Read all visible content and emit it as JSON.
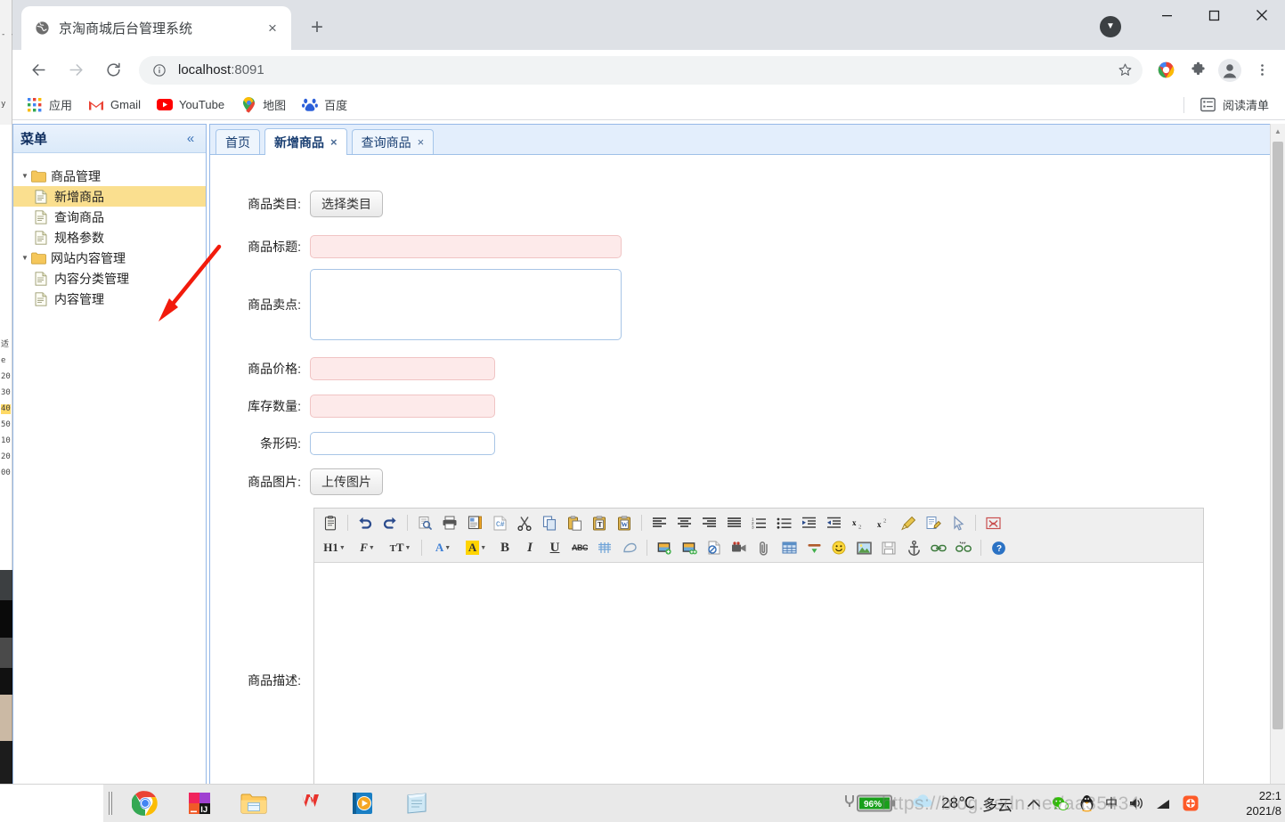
{
  "browser": {
    "tab": {
      "title": "京淘商城后台管理系统",
      "favicon": "globe-icon",
      "close": "×"
    },
    "new_tab": "+",
    "window_controls": {
      "minimize": "minimize-icon",
      "maximize": "maximize-icon",
      "close": "close-icon"
    },
    "alert_badge": "▼",
    "nav": {
      "back": "←",
      "forward": "→",
      "reload": "↻"
    },
    "omnibox": {
      "info_icon": "info-circle-icon",
      "host": "localhost",
      "port": ":8091",
      "star": "star-icon"
    },
    "toolbar_icons": [
      "chrome-profile-color-icon",
      "extensions-puzzle-icon",
      "profile-avatar-icon",
      "three-dot-menu-icon"
    ],
    "bookmarks": [
      {
        "label": "应用",
        "icon": "apps-grid-icon"
      },
      {
        "label": "Gmail",
        "icon": "gmail-icon"
      },
      {
        "label": "YouTube",
        "icon": "youtube-icon"
      },
      {
        "label": "地图",
        "icon": "maps-pin-icon"
      },
      {
        "label": "百度",
        "icon": "baidu-icon"
      }
    ],
    "reading_list": {
      "label": "阅读清单",
      "icon": "reading-list-icon"
    }
  },
  "sidebar": {
    "title": "菜单",
    "collapse_icon": "«",
    "tree": [
      {
        "label": "商品管理",
        "type": "folder",
        "level": 0,
        "selected": false
      },
      {
        "label": "新增商品",
        "type": "file",
        "level": 1,
        "selected": true
      },
      {
        "label": "查询商品",
        "type": "file",
        "level": 1,
        "selected": false
      },
      {
        "label": "规格参数",
        "type": "file",
        "level": 1,
        "selected": false
      },
      {
        "label": "网站内容管理",
        "type": "folder",
        "level": 0,
        "selected": false
      },
      {
        "label": "内容分类管理",
        "type": "file",
        "level": 1,
        "selected": false
      },
      {
        "label": "内容管理",
        "type": "file",
        "level": 1,
        "selected": false
      }
    ]
  },
  "content": {
    "tabs": [
      {
        "label": "首页",
        "closable": false,
        "active": false
      },
      {
        "label": "新增商品",
        "closable": true,
        "active": true
      },
      {
        "label": "查询商品",
        "closable": true,
        "active": false
      }
    ],
    "close_glyph": "×"
  },
  "form": {
    "fields": [
      {
        "label": "商品类目:",
        "control": "button",
        "value": "选择类目",
        "style": "grey"
      },
      {
        "label": "商品标题:",
        "control": "input",
        "value": "",
        "style": "required"
      },
      {
        "label": "商品卖点:",
        "control": "textarea",
        "value": "",
        "style": "normal"
      },
      {
        "label": "商品价格:",
        "control": "input",
        "value": "",
        "style": "required"
      },
      {
        "label": "库存数量:",
        "control": "input",
        "value": "",
        "style": "required"
      },
      {
        "label": "条形码:",
        "control": "input",
        "value": "",
        "style": "normal"
      },
      {
        "label": "商品图片:",
        "control": "button",
        "value": "上传图片",
        "style": "grey"
      },
      {
        "label": "商品描述:",
        "control": "editor",
        "value": "",
        "style": "normal"
      }
    ]
  },
  "editor": {
    "row1": [
      {
        "name": "paste-from-clipboard-icon",
        "glyph": "📋"
      },
      {
        "sep": true
      },
      {
        "name": "undo-icon",
        "glyph": "↶"
      },
      {
        "name": "redo-icon",
        "glyph": "↷"
      },
      {
        "sep": true
      },
      {
        "name": "preview-icon",
        "glyph": "🔍"
      },
      {
        "name": "print-icon",
        "glyph": "🖨"
      },
      {
        "name": "templates-icon",
        "glyph": "▤"
      },
      {
        "name": "source-csharp-icon",
        "glyph": "C#"
      },
      {
        "name": "cut-icon",
        "glyph": "✂"
      },
      {
        "name": "copy-icon",
        "glyph": "⧉"
      },
      {
        "name": "paste-icon",
        "glyph": "📋"
      },
      {
        "name": "paste-as-text-icon",
        "glyph": "T"
      },
      {
        "name": "paste-from-word-icon",
        "glyph": "W"
      },
      {
        "sep": true
      },
      {
        "name": "align-left-icon",
        "glyph": "≡"
      },
      {
        "name": "align-center-icon",
        "glyph": "≡"
      },
      {
        "name": "align-right-icon",
        "glyph": "≡"
      },
      {
        "name": "align-justify-icon",
        "glyph": "≡"
      },
      {
        "name": "numbered-list-icon",
        "glyph": "≣"
      },
      {
        "name": "bulleted-list-icon",
        "glyph": "≣"
      },
      {
        "name": "indent-increase-icon",
        "glyph": "⇥"
      },
      {
        "name": "indent-decrease-icon",
        "glyph": "⇤"
      },
      {
        "name": "subscript-icon",
        "glyph": "x₂"
      },
      {
        "name": "superscript-icon",
        "glyph": "x²"
      },
      {
        "name": "format-painter-icon",
        "glyph": "🧹"
      },
      {
        "name": "edit-source-icon",
        "glyph": "✎"
      },
      {
        "name": "select-cursor-icon",
        "glyph": "➤"
      },
      {
        "sep": true
      },
      {
        "name": "show-blocks-icon",
        "glyph": "⬚"
      }
    ],
    "row2": [
      {
        "name": "heading-h1-icon",
        "glyph": "H1",
        "caret": true,
        "wide": true
      },
      {
        "name": "font-family-icon",
        "glyph": "ℱ",
        "caret": true,
        "wide": true
      },
      {
        "name": "font-size-icon",
        "glyph": "ᴛT",
        "caret": true,
        "wide": true
      },
      {
        "sep": true
      },
      {
        "name": "text-color-icon",
        "glyph": "A",
        "caret": true,
        "wide": true
      },
      {
        "name": "background-color-icon",
        "glyph": "A",
        "caret": true,
        "wide": true
      },
      {
        "name": "bold-icon",
        "glyph": "B"
      },
      {
        "name": "italic-icon",
        "glyph": "I"
      },
      {
        "name": "underline-icon",
        "glyph": "U"
      },
      {
        "name": "strikethrough-icon",
        "glyph": "ABC"
      },
      {
        "name": "remove-format-icon",
        "glyph": "⌗"
      },
      {
        "name": "eraser-icon",
        "glyph": "◡"
      },
      {
        "sep": true
      },
      {
        "name": "insert-image-icon",
        "glyph": "🖼"
      },
      {
        "name": "multi-image-icon",
        "glyph": "🖼"
      },
      {
        "name": "page-break-icon",
        "glyph": "📄"
      },
      {
        "name": "insert-video-icon",
        "glyph": "🎥"
      },
      {
        "name": "attachment-icon",
        "glyph": "📎"
      },
      {
        "name": "insert-table-icon",
        "glyph": "⊞"
      },
      {
        "name": "horizontal-rule-icon",
        "glyph": "—"
      },
      {
        "name": "emoticon-icon",
        "glyph": "🙂"
      },
      {
        "name": "image-gallery-icon",
        "glyph": "🏞"
      },
      {
        "name": "save-icon",
        "glyph": "💾"
      },
      {
        "name": "anchor-icon",
        "glyph": "⚓"
      },
      {
        "name": "link-icon",
        "glyph": "🔗"
      },
      {
        "name": "unlink-icon",
        "glyph": "⛓"
      },
      {
        "sep": true
      },
      {
        "name": "help-icon",
        "glyph": "?"
      }
    ]
  },
  "taskbar": {
    "apps": [
      {
        "name": "chrome-taskbar-icon",
        "label": "Chrome"
      },
      {
        "name": "intellij-idea-taskbar-icon",
        "label": "IntelliJ IDEA"
      },
      {
        "name": "file-explorer-taskbar-icon",
        "label": "File Explorer"
      },
      {
        "name": "wps-office-taskbar-icon",
        "label": "WPS Office"
      },
      {
        "name": "media-player-taskbar-icon",
        "label": "Media Player"
      },
      {
        "name": "notepad-taskbar-icon",
        "label": "Notepad"
      }
    ],
    "battery": {
      "percent": "96%",
      "state": "charging"
    },
    "weather": {
      "temp": "28℃",
      "desc": "多云",
      "icon": "cloud-icon"
    },
    "tray": [
      {
        "name": "show-hidden-icons-chevron",
        "glyph": "∧"
      },
      {
        "name": "wechat-tray-icon",
        "glyph": ""
      },
      {
        "name": "qq-tray-icon",
        "glyph": ""
      },
      {
        "name": "input-method-tray-icon",
        "glyph": "中"
      },
      {
        "name": "volume-tray-icon",
        "glyph": "🔊"
      },
      {
        "name": "network-tray-icon",
        "glyph": ""
      },
      {
        "name": "sogou-tray-icon",
        "glyph": ""
      }
    ],
    "clock": {
      "time": "22:1",
      "date": "2021/8"
    }
  },
  "watermark": "https://blog.csdn.net/aa35434",
  "colors": {
    "chrome_tabstrip": "#dee1e6",
    "panel_border": "#95b8e7",
    "tab_header_bg": "#e3eefc",
    "selected_tree": "#fadf8f",
    "required_field_bg": "#fdeaea",
    "required_field_border": "#f0c4c4",
    "normal_field_border": "#a8c5e6",
    "editor_toolbar_bg": "#efefef",
    "annotation_arrow": "#f21b0c",
    "battery_green": "#18a01a"
  }
}
